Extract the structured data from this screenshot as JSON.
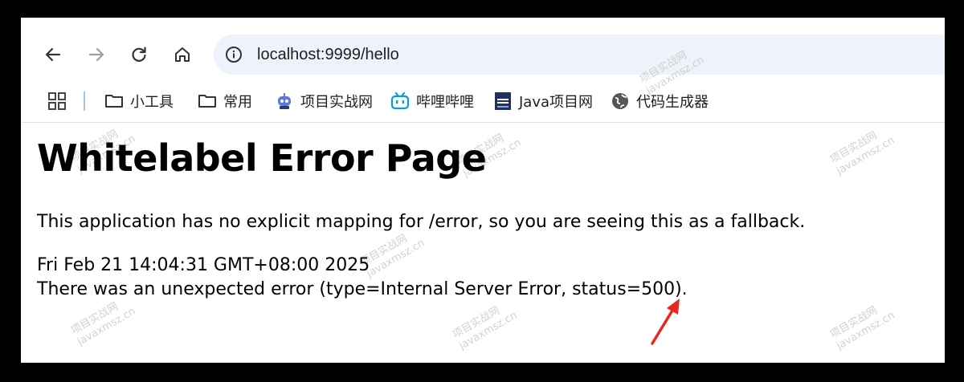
{
  "toolbar": {
    "icons": [
      "back-icon",
      "forward-icon",
      "reload-icon",
      "home-icon"
    ],
    "address_bar": {
      "url": "localhost:9999/hello",
      "icon": "info-icon"
    }
  },
  "bookmarks": [
    {
      "label": "小工具",
      "icon": "folder-icon"
    },
    {
      "label": "常用",
      "icon": "folder-icon"
    },
    {
      "label": "项目实战网",
      "icon": "robot-icon"
    },
    {
      "label": "哔哩哔哩",
      "icon": "bilibili-icon"
    },
    {
      "label": "Java项目网",
      "icon": "book-icon"
    },
    {
      "label": "代码生成器",
      "icon": "globe-icon"
    }
  ],
  "page": {
    "title": "Whitelabel Error Page",
    "message": "This application has no explicit mapping for /error, so you are seeing this as a fallback.",
    "timestamp": "Fri Feb 21 14:04:31 GMT+08:00 2025",
    "error_line": "There was an unexpected error (type=Internal Server Error, status=500)."
  },
  "watermark": {
    "line1": "项目实战网",
    "line2": "javaxmsz.cn"
  },
  "annotation": {
    "arrow_color": "#e8281e"
  }
}
